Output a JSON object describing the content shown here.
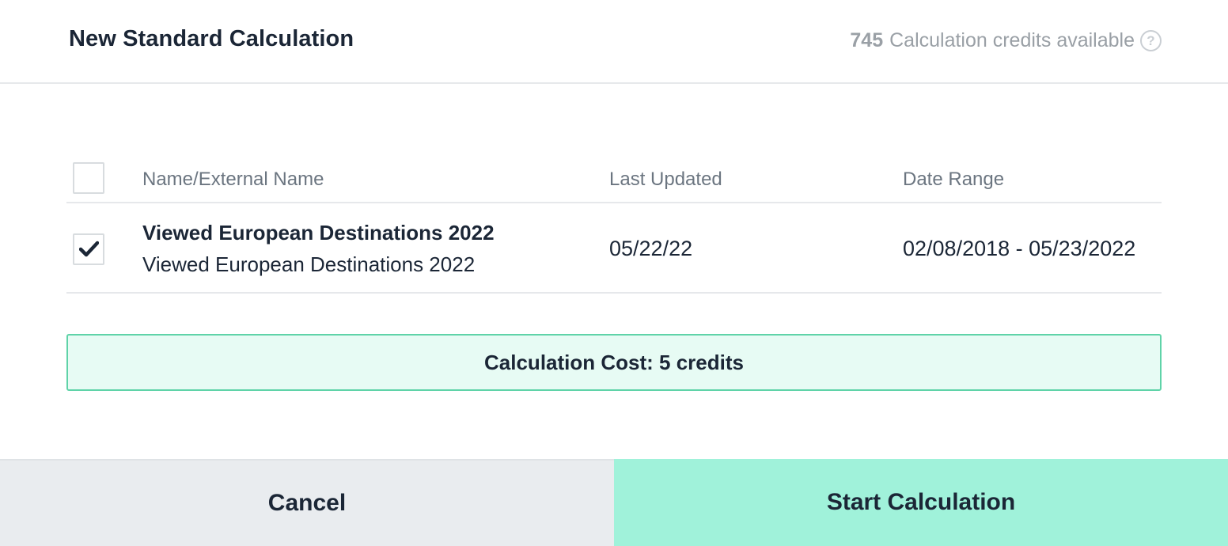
{
  "header": {
    "title": "New Standard Calculation",
    "credits_count": "745",
    "credits_label": "Calculation credits available",
    "help_icon": "question-circle-icon"
  },
  "table": {
    "columns": {
      "name": "Name/External Name",
      "last_updated": "Last Updated",
      "date_range": "Date Range"
    },
    "select_all_checked": false,
    "rows": [
      {
        "checked": true,
        "name": "Viewed European Destinations 2022",
        "external_name": "Viewed European Destinations 2022",
        "last_updated": "05/22/22",
        "date_range": "02/08/2018 - 05/23/2022"
      }
    ]
  },
  "cost": {
    "text": "Calculation Cost: 5 credits"
  },
  "footer": {
    "cancel_label": "Cancel",
    "start_label": "Start Calculation"
  },
  "colors": {
    "accent": "#a0f2da",
    "cost_background": "#e7fbf4",
    "cost_border": "#5fd3a8",
    "text_primary": "#1b2636",
    "text_muted": "#9aa0a6"
  }
}
